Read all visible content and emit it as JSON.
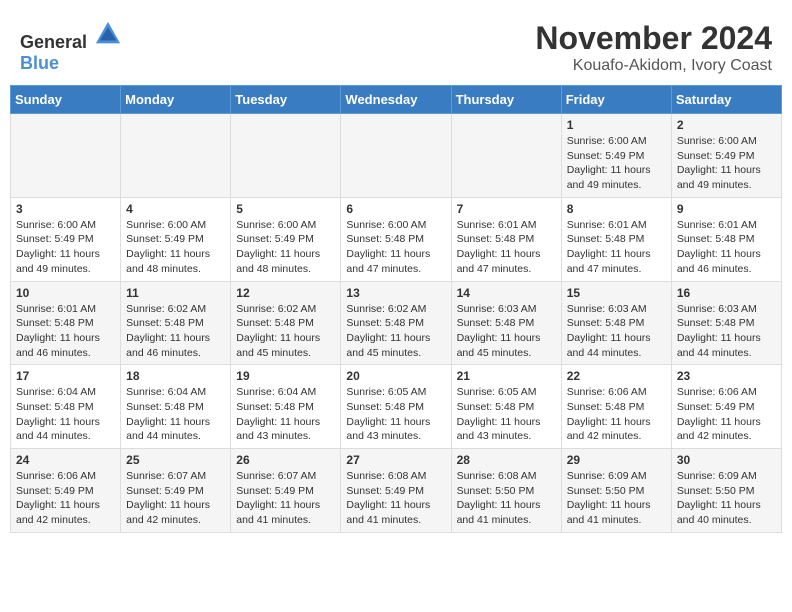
{
  "header": {
    "logo_general": "General",
    "logo_blue": "Blue",
    "month_title": "November 2024",
    "location": "Kouafo-Akidom, Ivory Coast"
  },
  "weekdays": [
    "Sunday",
    "Monday",
    "Tuesday",
    "Wednesday",
    "Thursday",
    "Friday",
    "Saturday"
  ],
  "weeks": [
    [
      {
        "day": "",
        "info": ""
      },
      {
        "day": "",
        "info": ""
      },
      {
        "day": "",
        "info": ""
      },
      {
        "day": "",
        "info": ""
      },
      {
        "day": "",
        "info": ""
      },
      {
        "day": "1",
        "info": "Sunrise: 6:00 AM\nSunset: 5:49 PM\nDaylight: 11 hours and 49 minutes."
      },
      {
        "day": "2",
        "info": "Sunrise: 6:00 AM\nSunset: 5:49 PM\nDaylight: 11 hours and 49 minutes."
      }
    ],
    [
      {
        "day": "3",
        "info": "Sunrise: 6:00 AM\nSunset: 5:49 PM\nDaylight: 11 hours and 49 minutes."
      },
      {
        "day": "4",
        "info": "Sunrise: 6:00 AM\nSunset: 5:49 PM\nDaylight: 11 hours and 48 minutes."
      },
      {
        "day": "5",
        "info": "Sunrise: 6:00 AM\nSunset: 5:49 PM\nDaylight: 11 hours and 48 minutes."
      },
      {
        "day": "6",
        "info": "Sunrise: 6:00 AM\nSunset: 5:48 PM\nDaylight: 11 hours and 47 minutes."
      },
      {
        "day": "7",
        "info": "Sunrise: 6:01 AM\nSunset: 5:48 PM\nDaylight: 11 hours and 47 minutes."
      },
      {
        "day": "8",
        "info": "Sunrise: 6:01 AM\nSunset: 5:48 PM\nDaylight: 11 hours and 47 minutes."
      },
      {
        "day": "9",
        "info": "Sunrise: 6:01 AM\nSunset: 5:48 PM\nDaylight: 11 hours and 46 minutes."
      }
    ],
    [
      {
        "day": "10",
        "info": "Sunrise: 6:01 AM\nSunset: 5:48 PM\nDaylight: 11 hours and 46 minutes."
      },
      {
        "day": "11",
        "info": "Sunrise: 6:02 AM\nSunset: 5:48 PM\nDaylight: 11 hours and 46 minutes."
      },
      {
        "day": "12",
        "info": "Sunrise: 6:02 AM\nSunset: 5:48 PM\nDaylight: 11 hours and 45 minutes."
      },
      {
        "day": "13",
        "info": "Sunrise: 6:02 AM\nSunset: 5:48 PM\nDaylight: 11 hours and 45 minutes."
      },
      {
        "day": "14",
        "info": "Sunrise: 6:03 AM\nSunset: 5:48 PM\nDaylight: 11 hours and 45 minutes."
      },
      {
        "day": "15",
        "info": "Sunrise: 6:03 AM\nSunset: 5:48 PM\nDaylight: 11 hours and 44 minutes."
      },
      {
        "day": "16",
        "info": "Sunrise: 6:03 AM\nSunset: 5:48 PM\nDaylight: 11 hours and 44 minutes."
      }
    ],
    [
      {
        "day": "17",
        "info": "Sunrise: 6:04 AM\nSunset: 5:48 PM\nDaylight: 11 hours and 44 minutes."
      },
      {
        "day": "18",
        "info": "Sunrise: 6:04 AM\nSunset: 5:48 PM\nDaylight: 11 hours and 44 minutes."
      },
      {
        "day": "19",
        "info": "Sunrise: 6:04 AM\nSunset: 5:48 PM\nDaylight: 11 hours and 43 minutes."
      },
      {
        "day": "20",
        "info": "Sunrise: 6:05 AM\nSunset: 5:48 PM\nDaylight: 11 hours and 43 minutes."
      },
      {
        "day": "21",
        "info": "Sunrise: 6:05 AM\nSunset: 5:48 PM\nDaylight: 11 hours and 43 minutes."
      },
      {
        "day": "22",
        "info": "Sunrise: 6:06 AM\nSunset: 5:48 PM\nDaylight: 11 hours and 42 minutes."
      },
      {
        "day": "23",
        "info": "Sunrise: 6:06 AM\nSunset: 5:49 PM\nDaylight: 11 hours and 42 minutes."
      }
    ],
    [
      {
        "day": "24",
        "info": "Sunrise: 6:06 AM\nSunset: 5:49 PM\nDaylight: 11 hours and 42 minutes."
      },
      {
        "day": "25",
        "info": "Sunrise: 6:07 AM\nSunset: 5:49 PM\nDaylight: 11 hours and 42 minutes."
      },
      {
        "day": "26",
        "info": "Sunrise: 6:07 AM\nSunset: 5:49 PM\nDaylight: 11 hours and 41 minutes."
      },
      {
        "day": "27",
        "info": "Sunrise: 6:08 AM\nSunset: 5:49 PM\nDaylight: 11 hours and 41 minutes."
      },
      {
        "day": "28",
        "info": "Sunrise: 6:08 AM\nSunset: 5:50 PM\nDaylight: 11 hours and 41 minutes."
      },
      {
        "day": "29",
        "info": "Sunrise: 6:09 AM\nSunset: 5:50 PM\nDaylight: 11 hours and 41 minutes."
      },
      {
        "day": "30",
        "info": "Sunrise: 6:09 AM\nSunset: 5:50 PM\nDaylight: 11 hours and 40 minutes."
      }
    ]
  ]
}
